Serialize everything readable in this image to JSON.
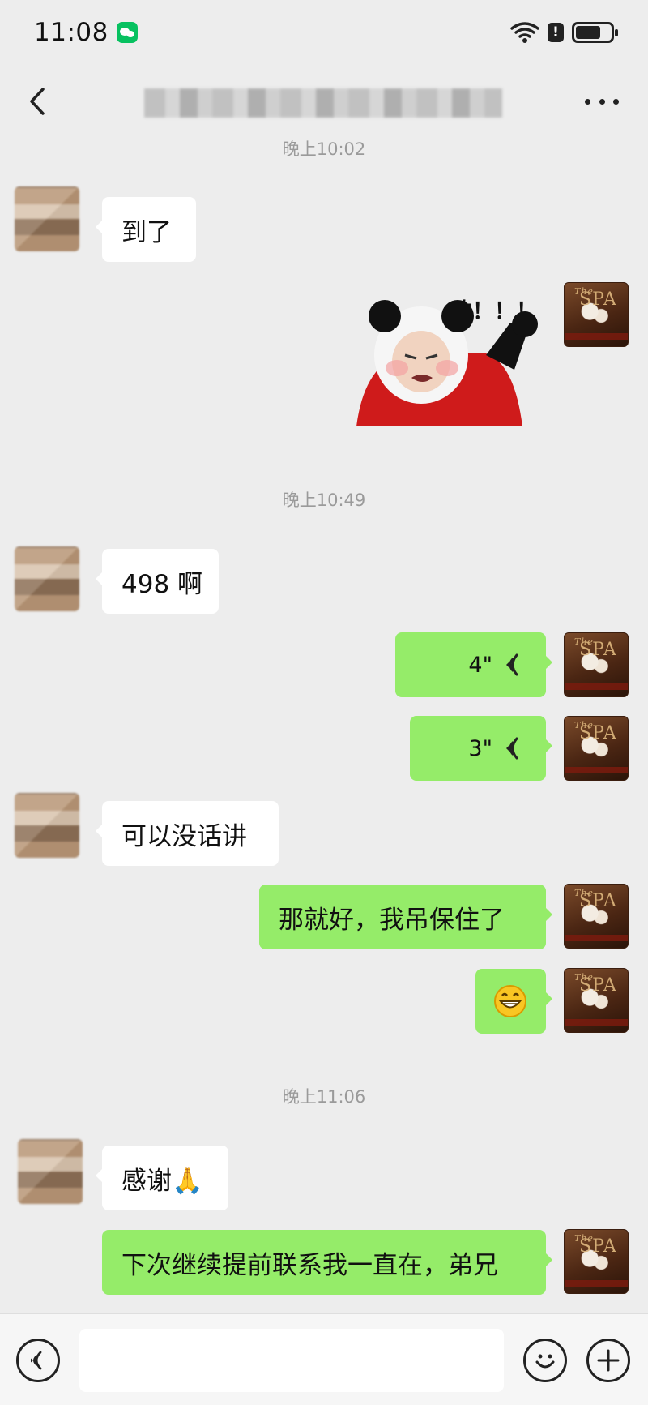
{
  "status_bar": {
    "time": "11:08",
    "alert": "!"
  },
  "nav": {
    "title_obscured": true
  },
  "messages": {
    "ts1": "晚上10:02",
    "m1": "到了",
    "sticker_text": "冲！！！",
    "ts2": "晚上10:49",
    "m2": "498 啊",
    "v1_duration": "4\"",
    "v2_duration": "3\"",
    "m3": "可以没话讲",
    "m4": "那就好，我吊保住了",
    "m5_emoji": "😁",
    "ts3": "晚上11:06",
    "m6": "感谢🙏",
    "m7": "下次继续提前联系我一直在，弟兄"
  },
  "avatars": {
    "contact_obscured": true,
    "self_text": "SPA",
    "self_small": "The"
  },
  "colors": {
    "background": "#ededed",
    "incoming_bubble": "#ffffff",
    "outgoing_bubble": "#95ec69",
    "timestamp_text": "#9a9a9a",
    "wechat_green": "#07c160"
  },
  "icons": {
    "back": "chevron-left-icon",
    "more": "more-dots-icon",
    "wifi": "wifi-icon",
    "battery": "battery-icon",
    "voice_wave": "voice-wave-icon",
    "voice_mode": "voice-mode-icon",
    "emoji": "emoji-icon",
    "plus": "plus-icon"
  }
}
